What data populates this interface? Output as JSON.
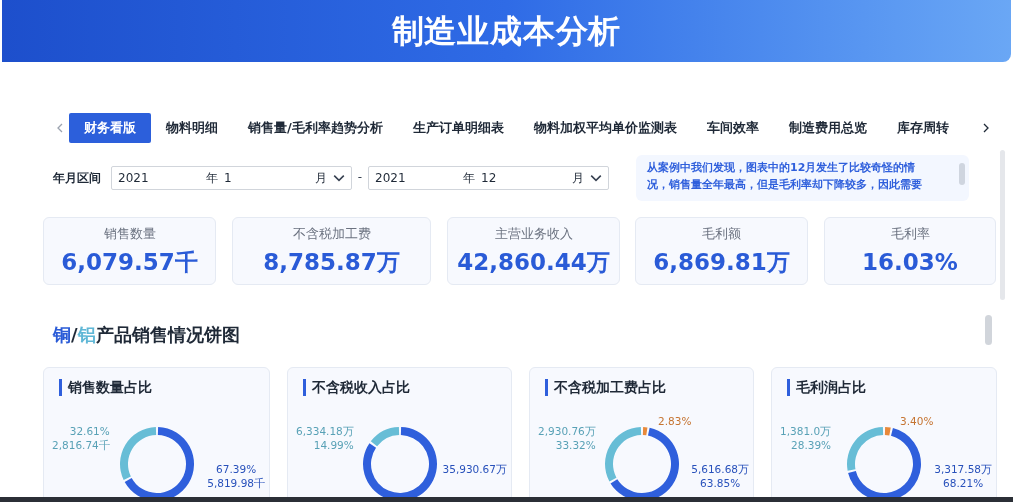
{
  "header": {
    "title": "制造业成本分析"
  },
  "tabs": [
    {
      "label": "财务看版",
      "selected": true
    },
    {
      "label": "物料明细",
      "selected": false
    },
    {
      "label": "销售量/毛利率趋势分析",
      "selected": false
    },
    {
      "label": "生产订单明细表",
      "selected": false
    },
    {
      "label": "物料加权平均单价监测表",
      "selected": false
    },
    {
      "label": "车间效率",
      "selected": false
    },
    {
      "label": "制造费用总览",
      "selected": false
    },
    {
      "label": "库存周转",
      "selected": false
    }
  ],
  "filter": {
    "label": "年月区间",
    "separator": "-",
    "ranges": [
      {
        "year": "2021",
        "year_unit": "年",
        "month": "1",
        "month_unit": "月"
      },
      {
        "year": "2021",
        "year_unit": "年",
        "month": "12",
        "month_unit": "月"
      }
    ]
  },
  "note": {
    "lines": [
      "从案例中我们发现，图表中的12月发生了比较奇怪的情",
      "况，销售量全年最高，但是毛利率却下降较多，因此需要"
    ]
  },
  "kpis": [
    {
      "label": "销售数量",
      "value": "6,079.57千"
    },
    {
      "label": "不含税加工费",
      "value": "8,785.87万"
    },
    {
      "label": "主营业务收入",
      "value": "42,860.44万"
    },
    {
      "label": "毛利额",
      "value": "6,869.81万"
    },
    {
      "label": "毛利率",
      "value": "16.03%"
    }
  ],
  "section": {
    "title_parts": [
      {
        "text": "铜",
        "color": "#2a5bd7"
      },
      {
        "text": "/",
        "color": "#1f2937"
      },
      {
        "text": "铝",
        "color": "#5fb7d6"
      },
      {
        "text": "产品销售情况饼图",
        "color": "#1f2937"
      }
    ]
  },
  "charts": [
    {
      "title": "销售数量占比",
      "slices": [
        {
          "color": "#2f5fdc",
          "lines": [
            "67.39%",
            "5,819.98千"
          ]
        },
        {
          "color": "#67bdd6",
          "lines": [
            "32.61%",
            "2,816.74千"
          ]
        }
      ],
      "chart_data": {
        "type": "donut",
        "values": [
          67.39,
          32.61
        ]
      }
    },
    {
      "title": "不含税收入占比",
      "slices": [
        {
          "color": "#2f5fdc",
          "lines": [
            "35,930.67万"
          ]
        },
        {
          "color": "#67bdd6",
          "lines": [
            "6,334.18万",
            "14.99%"
          ]
        }
      ],
      "chart_data": {
        "type": "donut",
        "values": [
          85.01,
          14.99
        ]
      }
    },
    {
      "title": "不含税加工费占比",
      "slices": [
        {
          "color": "#e8893a",
          "lines": [
            "2.83%"
          ]
        },
        {
          "color": "#2f5fdc",
          "lines": [
            "5,616.68万",
            "63.85%"
          ]
        },
        {
          "color": "#67bdd6",
          "lines": [
            "2,930.76万",
            "33.32%"
          ]
        }
      ],
      "chart_data": {
        "type": "donut",
        "values": [
          2.83,
          63.85,
          33.32
        ]
      }
    },
    {
      "title": "毛利润占比",
      "slices": [
        {
          "color": "#e8893a",
          "lines": [
            "3.40%"
          ]
        },
        {
          "color": "#2f5fdc",
          "lines": [
            "3,317.58万",
            "68.21%"
          ]
        },
        {
          "color": "#67bdd6",
          "lines": [
            "1,381.0万",
            "28.39%"
          ]
        }
      ],
      "chart_data": {
        "type": "donut",
        "values": [
          3.4,
          68.21,
          28.39
        ]
      }
    }
  ]
}
